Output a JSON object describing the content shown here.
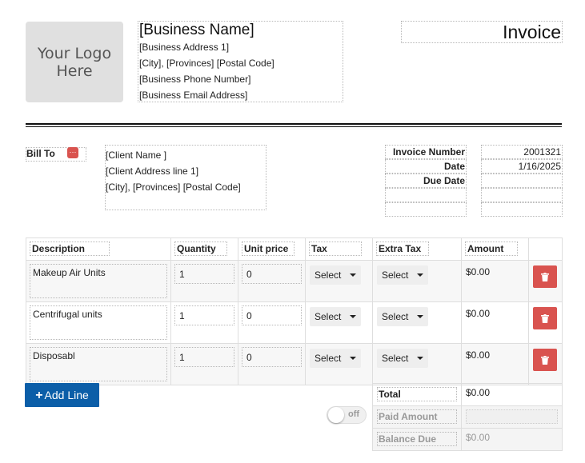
{
  "header": {
    "logo_text": "Your Logo Here",
    "business_name": "[Business Name]",
    "business_address": "[Business Address 1]",
    "business_city": "[City], [Provinces] [Postal Code]",
    "business_phone": "[Business Phone Number]",
    "business_email": "[Business Email Address]",
    "invoice_title": "Invoice"
  },
  "bill_to": {
    "label": "Bill To",
    "icon_text": "···",
    "client_name": "[Client Name ]",
    "client_address": "[Client Address line 1]",
    "client_city": "[City], [Provinces] [Postal Code]"
  },
  "meta": {
    "invoice_number_label": "Invoice Number",
    "invoice_number": "2001321",
    "date_label": "Date",
    "date": "1/16/2025",
    "due_date_label": "Due Date",
    "due_date": ""
  },
  "table": {
    "columns": [
      "Description",
      "Quantity",
      "Unit price",
      "Tax",
      "Extra Tax",
      "Amount"
    ],
    "select_label": "Select",
    "rows": [
      {
        "description": "Makeup Air Units",
        "quantity": "1",
        "unit_price": "0",
        "amount": "$0.00"
      },
      {
        "description": "Centrifugal units",
        "quantity": "1",
        "unit_price": "0",
        "amount": "$0.00"
      },
      {
        "description": "Disposabl",
        "quantity": "1",
        "unit_price": "0",
        "amount": "$0.00"
      }
    ]
  },
  "actions": {
    "add_line_plus": "+",
    "add_line_label": "Add Line",
    "toggle_label": "off"
  },
  "totals": {
    "total_label": "Total",
    "total_value": "$0.00",
    "paid_label": "Paid Amount",
    "paid_value": "",
    "balance_label": "Balance Due",
    "balance_value": "$0.00"
  },
  "colors": {
    "accent_blue": "#0b5ea8",
    "delete_red": "#d9534f",
    "logo_gray": "#e0e0e0"
  },
  "icons": {
    "delete": "trash-icon",
    "bill_menu": "more-icon",
    "add": "plus-icon",
    "select_caret": "caret-down-icon"
  }
}
